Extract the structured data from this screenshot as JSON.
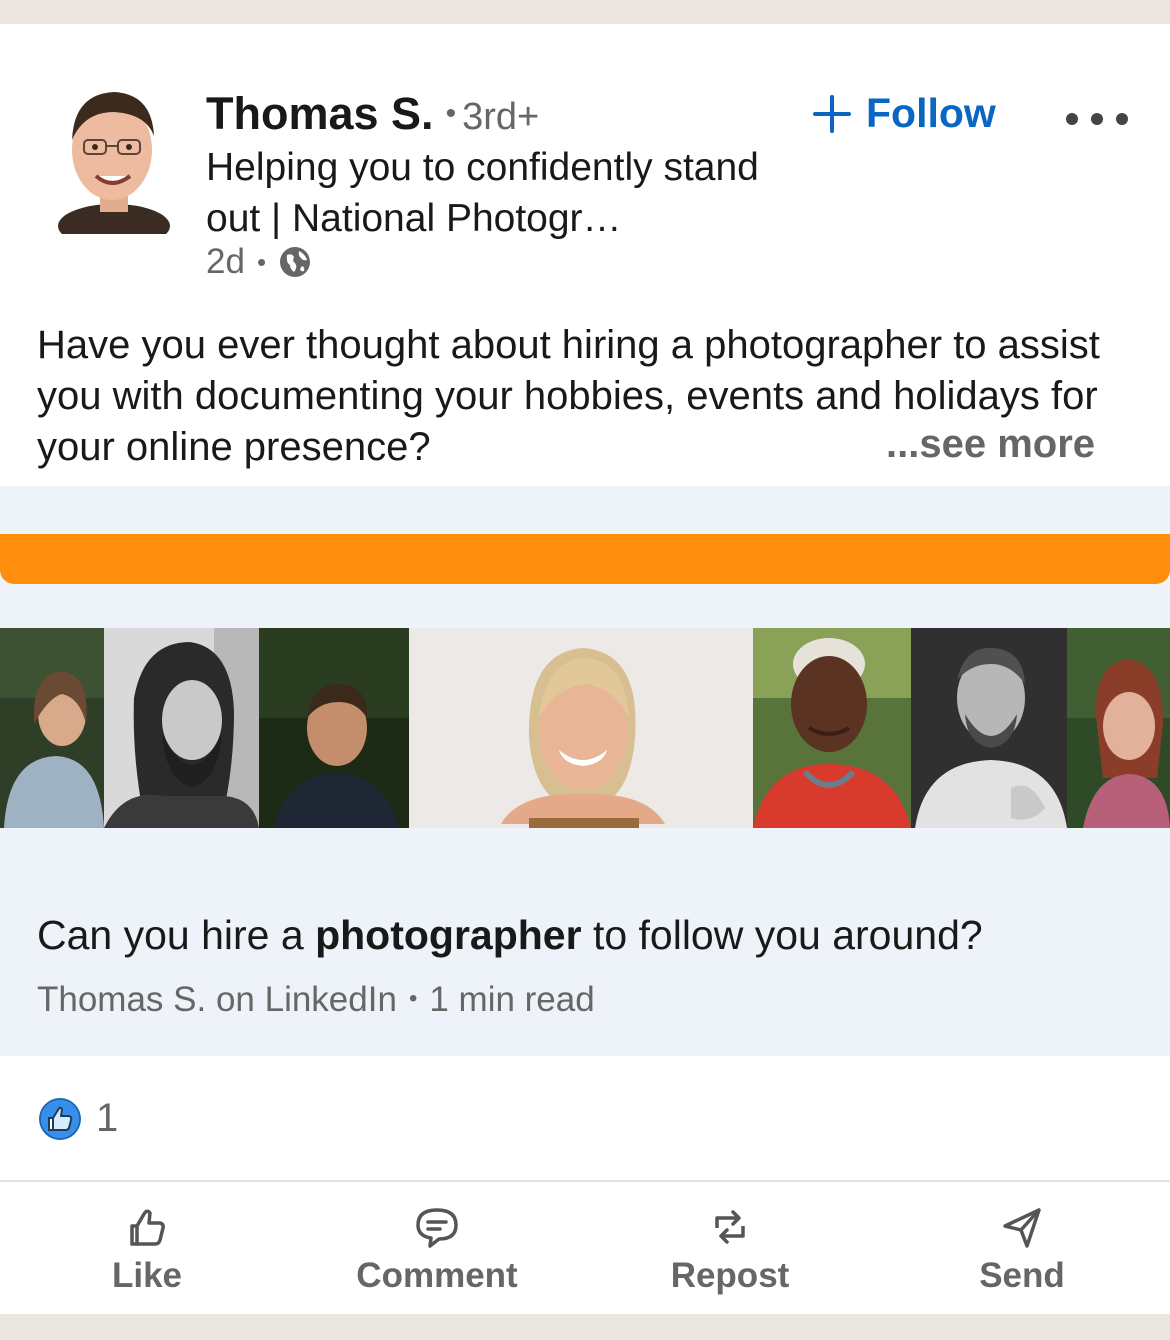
{
  "post": {
    "author": {
      "name": "Thomas S.",
      "degree": "3rd+",
      "headline": "Helping you to confidently stand out | National Photogr…",
      "time": "2d"
    },
    "follow_label": "Follow",
    "text": "Have you ever thought about hiring a photographer to assist you with documenting your hobbies, events and holidays for your online presence?",
    "see_more": "...see more"
  },
  "article": {
    "title_before": "Can you hire a ",
    "title_bold": "photographer",
    "title_after": " to follow you around?",
    "source": "Thomas S. on LinkedIn",
    "read_time": "1 min read",
    "banner_color": "#fe8e0c"
  },
  "reactions": {
    "count": "1",
    "icon": "thumbs-up-icon"
  },
  "actions": {
    "like": "Like",
    "comment": "Comment",
    "repost": "Repost",
    "send": "Send"
  },
  "colors": {
    "accent": "#0a66c2",
    "muted": "#666666",
    "page_bg": "#ebe7e0",
    "article_bg": "#edf3f8"
  }
}
